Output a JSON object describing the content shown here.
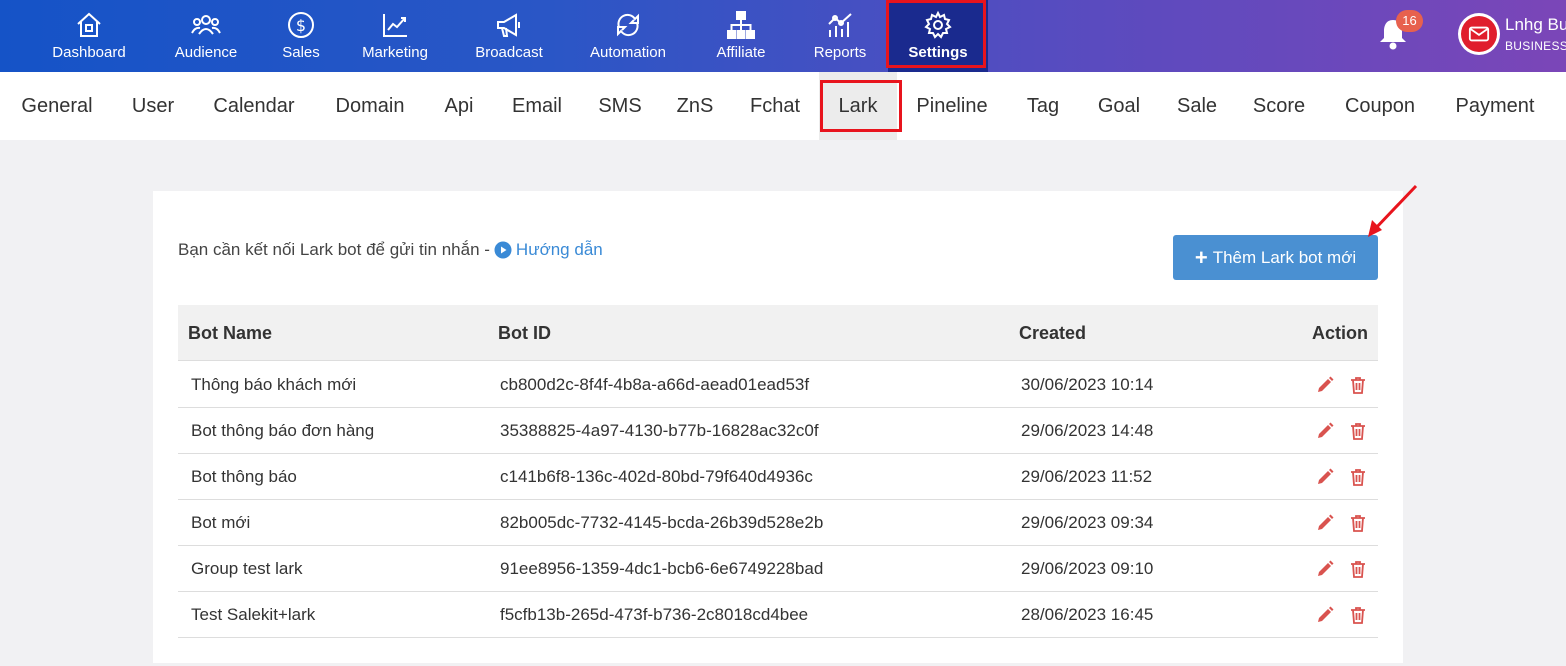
{
  "topnav": {
    "items": [
      {
        "label": "Dashboard",
        "icon": "home-icon"
      },
      {
        "label": "Audience",
        "icon": "users-icon"
      },
      {
        "label": "Sales",
        "icon": "dollar-icon"
      },
      {
        "label": "Marketing",
        "icon": "chart-up-icon"
      },
      {
        "label": "Broadcast",
        "icon": "megaphone-icon"
      },
      {
        "label": "Automation",
        "icon": "sync-icon"
      },
      {
        "label": "Affiliate",
        "icon": "network-icon"
      },
      {
        "label": "Reports",
        "icon": "report-chart-icon"
      },
      {
        "label": "Settings",
        "icon": "gear-icon"
      }
    ],
    "active": "Settings",
    "notification_count": "16",
    "user_name": "Lnhg Bu",
    "user_role": "BUSINESS"
  },
  "subnav": {
    "tabs": [
      "General",
      "User",
      "Calendar",
      "Domain",
      "Api",
      "Email",
      "SMS",
      "ZnS",
      "Fchat",
      "Lark",
      "Pineline",
      "Tag",
      "Goal",
      "Sale",
      "Score",
      "Coupon",
      "Payment"
    ],
    "active": "Lark"
  },
  "content": {
    "info_text": "Bạn cần kết nối Lark bot để gửi tin nhắn -",
    "guide_link": "Hướng dẫn",
    "add_button": "Thêm Lark bot mới",
    "colors": {
      "accent": "#4a90d2",
      "danger": "#d9534f",
      "highlight": "#e8141d"
    }
  },
  "table": {
    "headers": {
      "name": "Bot Name",
      "id": "Bot ID",
      "created": "Created",
      "action": "Action"
    },
    "rows": [
      {
        "name": "Thông báo khách mới",
        "id": "cb800d2c-8f4f-4b8a-a66d-aead01ead53f",
        "created": "30/06/2023 10:14"
      },
      {
        "name": "Bot thông báo đơn hàng",
        "id": "35388825-4a97-4130-b77b-16828ac32c0f",
        "created": "29/06/2023 14:48"
      },
      {
        "name": "Bot thông báo",
        "id": "c141b6f8-136c-402d-80bd-79f640d4936c",
        "created": "29/06/2023 11:52"
      },
      {
        "name": "Bot mới",
        "id": "82b005dc-7732-4145-bcda-26b39d528e2b",
        "created": "29/06/2023 09:34"
      },
      {
        "name": "Group test lark",
        "id": "91ee8956-1359-4dc1-bcb6-6e6749228bad",
        "created": "29/06/2023 09:10"
      },
      {
        "name": "Test Salekit+lark",
        "id": "f5cfb13b-265d-473f-b736-2c8018cd4bee",
        "created": "28/06/2023 16:45"
      }
    ]
  }
}
